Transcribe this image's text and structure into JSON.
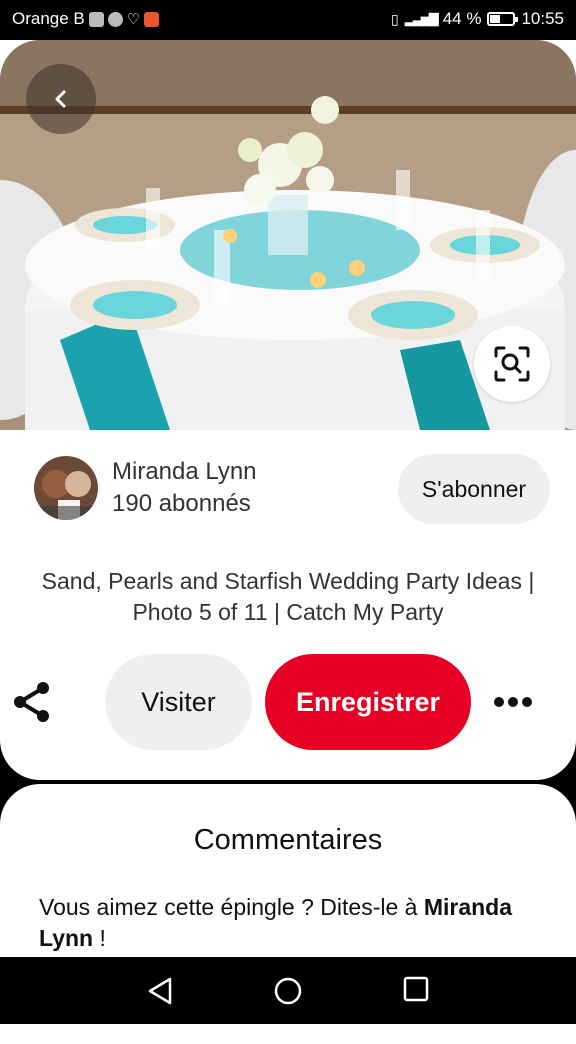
{
  "status_bar": {
    "carrier": "Orange B",
    "battery_percent": "44 %",
    "battery_level": 0.44,
    "time": "10:55",
    "icons": [
      "gallery-icon",
      "chrome-icon",
      "heart-icon",
      "app-icon",
      "vibrate-icon",
      "signal-icon",
      "battery-icon"
    ]
  },
  "pin": {
    "creator": {
      "name": "Miranda Lynn",
      "followers": "190 abonnés"
    },
    "follow_label": "S'abonner",
    "title": "Sand, Pearls and Starfish Wedding Party Ideas | Photo 5 of 11 | Catch My Party",
    "actions": {
      "visit_label": "Visiter",
      "save_label": "Enregistrer"
    }
  },
  "comments": {
    "heading": "Commentaires",
    "prompt_text": "Vous aimez cette épingle ? Dites-le à ",
    "prompt_name": "Miranda Lynn",
    "prompt_suffix": " !"
  },
  "colors": {
    "save_button": "#e60023",
    "button_gray": "#efefef",
    "accent_teal": "#1aa3ad"
  }
}
